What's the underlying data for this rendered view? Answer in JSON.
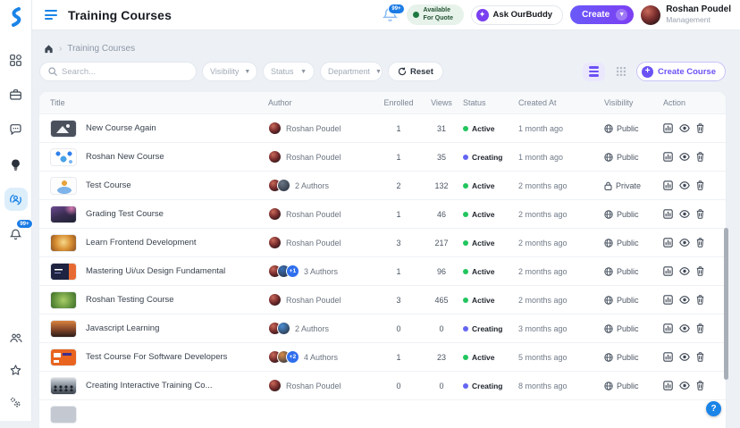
{
  "header": {
    "title": "Training Courses",
    "notification_count": "99+",
    "available_for_quote": "Available For Quote",
    "ask_ourbuddy": "Ask OurBuddy",
    "create_label": "Create",
    "user_name": "Roshan Poudel",
    "user_role": "Management"
  },
  "breadcrumb": {
    "current": "Training Courses"
  },
  "filters": {
    "search_placeholder": "Search...",
    "visibility_label": "Visibility",
    "status_label": "Status",
    "department_label": "Department",
    "reset_label": "Reset"
  },
  "toolbar": {
    "create_course_label": "Create Course"
  },
  "sidebar": {
    "notification_count": "99+",
    "items": [
      "dashboard",
      "projects",
      "messages",
      "ideas",
      "training-courses",
      "notifications"
    ],
    "active_item": "training-courses",
    "bottom_items": [
      "community",
      "favorites",
      "settings"
    ]
  },
  "table": {
    "columns": [
      "Title",
      "Author",
      "Enrolled",
      "Views",
      "Status",
      "Created At",
      "Visibility",
      "Action"
    ],
    "action_icons": [
      "analytics",
      "view",
      "delete"
    ],
    "rows": [
      {
        "title": "New Course Again",
        "author_label": "Roshan Poudel",
        "avatars": 1,
        "plus": "",
        "enrolled": "1",
        "views": "31",
        "status": "Active",
        "created": "1 month ago",
        "visibility": "Public",
        "thumb": "t1"
      },
      {
        "title": "Roshan New Course",
        "author_label": "Roshan Poudel",
        "avatars": 1,
        "plus": "",
        "enrolled": "1",
        "views": "35",
        "status": "Creating",
        "created": "1 month ago",
        "visibility": "Public",
        "thumb": "t2"
      },
      {
        "title": "Test Course",
        "author_label": "2 Authors",
        "avatars": 2,
        "plus": "",
        "enrolled": "2",
        "views": "132",
        "status": "Active",
        "created": "2 months ago",
        "visibility": "Private",
        "thumb": "t3"
      },
      {
        "title": "Grading Test Course",
        "author_label": "Roshan Poudel",
        "avatars": 1,
        "plus": "",
        "enrolled": "1",
        "views": "46",
        "status": "Active",
        "created": "2 months ago",
        "visibility": "Public",
        "thumb": "t4"
      },
      {
        "title": "Learn Frontend Development",
        "author_label": "Roshan Poudel",
        "avatars": 1,
        "plus": "",
        "enrolled": "3",
        "views": "217",
        "status": "Active",
        "created": "2 months ago",
        "visibility": "Public",
        "thumb": "t5"
      },
      {
        "title": "Mastering Ui/ux Design Fundamental",
        "author_label": "3 Authors",
        "avatars": 2,
        "plus": "+1",
        "enrolled": "1",
        "views": "96",
        "status": "Active",
        "created": "2 months ago",
        "visibility": "Public",
        "thumb": "t6"
      },
      {
        "title": "Roshan Testing Course",
        "author_label": "Roshan Poudel",
        "avatars": 1,
        "plus": "",
        "enrolled": "3",
        "views": "465",
        "status": "Active",
        "created": "2 months ago",
        "visibility": "Public",
        "thumb": "t7"
      },
      {
        "title": "Javascript Learning",
        "author_label": "2 Authors",
        "avatars": 2,
        "plus": "",
        "enrolled": "0",
        "views": "0",
        "status": "Creating",
        "created": "3 months ago",
        "visibility": "Public",
        "thumb": "t8"
      },
      {
        "title": "Test Course For Software Developers",
        "author_label": "4 Authors",
        "avatars": 2,
        "plus": "+2",
        "enrolled": "1",
        "views": "23",
        "status": "Active",
        "created": "5 months ago",
        "visibility": "Public",
        "thumb": "t9"
      },
      {
        "title": "Creating Interactive Training Co...",
        "author_label": "Roshan Poudel",
        "avatars": 1,
        "plus": "",
        "enrolled": "0",
        "views": "0",
        "status": "Creating",
        "created": "8 months ago",
        "visibility": "Public",
        "thumb": "t10"
      }
    ],
    "partial_row_thumb": "t11"
  },
  "colors": {
    "accent_blue": "#1b84e7",
    "accent_purple": "#6a52f4",
    "status_active": "#22c55e",
    "status_creating": "#6466f1"
  },
  "help": {
    "label": "?"
  }
}
